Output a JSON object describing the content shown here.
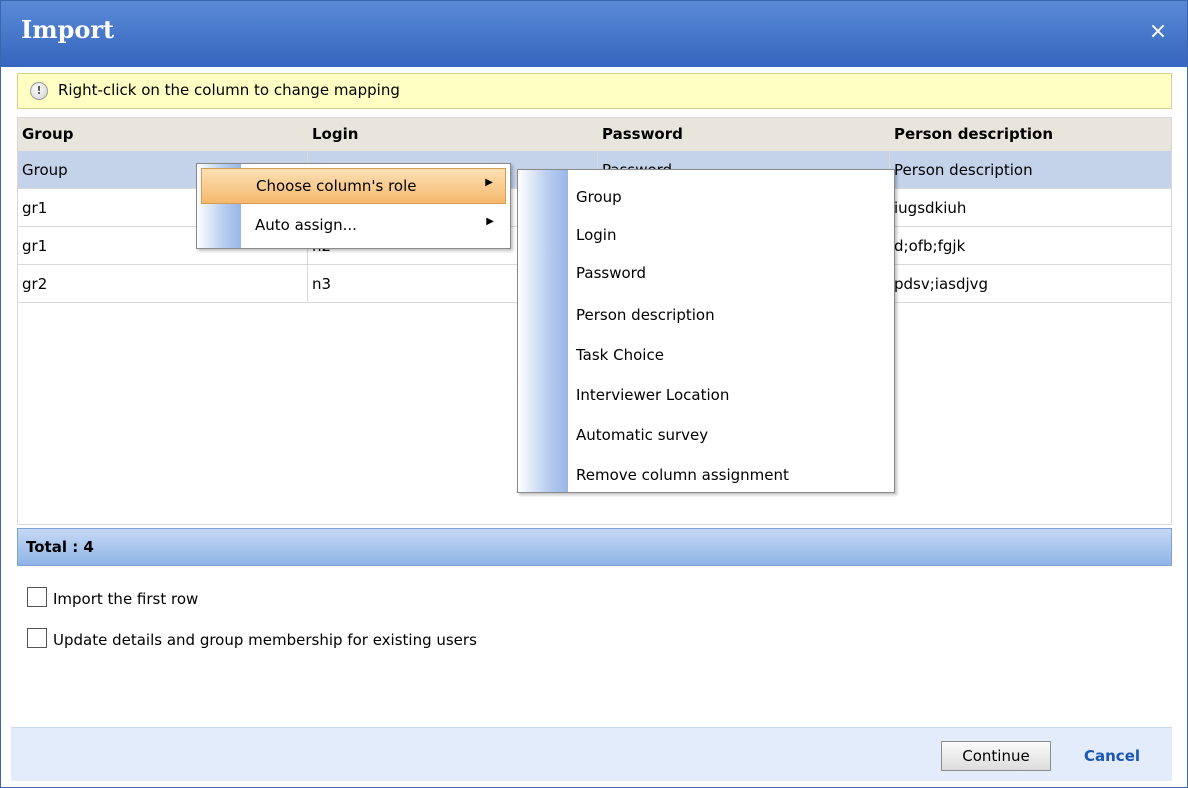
{
  "title": "Import",
  "close_glyph": "×",
  "hint": {
    "icon": "info-icon",
    "text": "Right-click on the column to change mapping"
  },
  "grid": {
    "headers": [
      "Group",
      "Login",
      "Password",
      "Person description"
    ],
    "rows": [
      [
        "Group",
        "",
        "Password",
        "Person description"
      ],
      [
        "gr1",
        "",
        "",
        "iugsdkiuh"
      ],
      [
        "gr1",
        "n2",
        "",
        "d;ofb;fgjk"
      ],
      [
        "gr2",
        "n3",
        "",
        "pdsv;iasdjvg"
      ]
    ]
  },
  "total": "Total : 4",
  "options": {
    "import_first_row": "Import the first row",
    "update_details": "Update details and group membership for existing users"
  },
  "footer": {
    "continue": "Continue",
    "cancel": "Cancel"
  },
  "context_menu": {
    "items": [
      {
        "label": "Choose column's role",
        "arrow": "▶"
      },
      {
        "label": "Auto assign...",
        "arrow": "▶"
      }
    ]
  },
  "role_menu": {
    "items": [
      "Group",
      "Login",
      "Password",
      "Person description",
      "Task Choice",
      "Interviewer Location",
      "Automatic survey",
      "Remove column assignment"
    ]
  }
}
